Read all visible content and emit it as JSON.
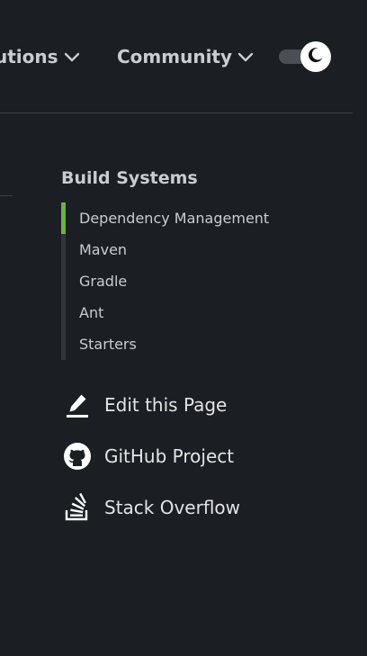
{
  "nav": {
    "items": [
      {
        "label": "utions",
        "icon": "chevron-down-icon"
      },
      {
        "label": "Community",
        "icon": "chevron-down-icon"
      }
    ],
    "theme_toggle": {
      "icon": "moon-icon"
    }
  },
  "toc": {
    "title": "Build Systems",
    "items": [
      {
        "label": "Dependency Management",
        "active": true
      },
      {
        "label": "Maven",
        "active": false
      },
      {
        "label": "Gradle",
        "active": false
      },
      {
        "label": "Ant",
        "active": false
      },
      {
        "label": "Starters",
        "active": false
      }
    ]
  },
  "actions": [
    {
      "label": "Edit this Page",
      "icon": "pencil-icon"
    },
    {
      "label": "GitHub Project",
      "icon": "github-icon"
    },
    {
      "label": "Stack Overflow",
      "icon": "stackoverflow-icon"
    }
  ],
  "colors": {
    "background": "#1b1f23",
    "accent": "#6db33f",
    "text": "#e4e4e4",
    "muted_text": "#c9ccd0"
  }
}
